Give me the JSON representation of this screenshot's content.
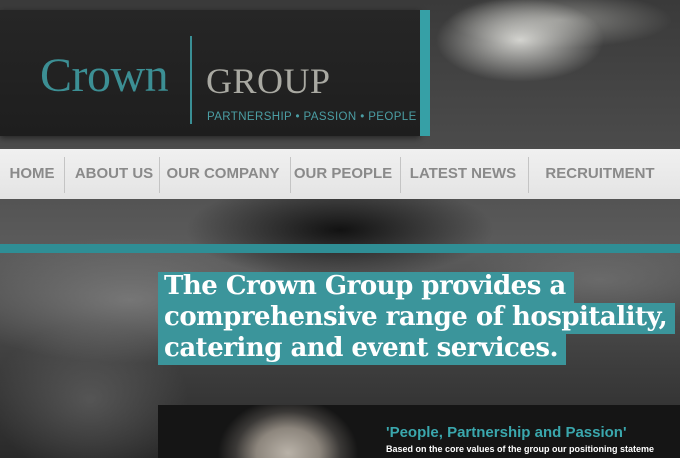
{
  "logo": {
    "name": "Crown",
    "group": "GROUP",
    "tagline": "PARTNERSHIP • PASSION • PEOPLE"
  },
  "nav": {
    "items": [
      {
        "label": "HOME"
      },
      {
        "label": "ABOUT US"
      },
      {
        "label": "OUR COMPANY"
      },
      {
        "label": "OUR PEOPLE"
      },
      {
        "label": "LATEST NEWS"
      },
      {
        "label": "RECRUITMENT"
      }
    ]
  },
  "hero": {
    "lines": [
      "The Crown Group provides a",
      "comprehensive range of hospitality,",
      "catering and event services."
    ]
  },
  "feature": {
    "title": "'People, Partnership and Passion'",
    "text": "Based on the core values of the group our positioning stateme"
  },
  "colors": {
    "accent": "#36a0a6",
    "nav_bg": "#e8e8e8",
    "nav_text": "#8a8a8a"
  }
}
